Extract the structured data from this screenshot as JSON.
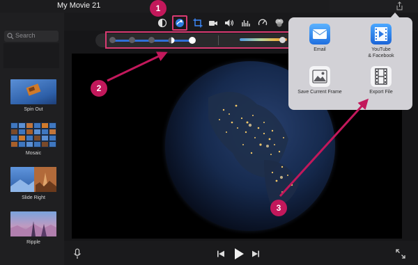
{
  "window": {
    "title": "My Movie 21"
  },
  "search": {
    "placeholder": "Search"
  },
  "transitions": [
    {
      "label": "Spin Out"
    },
    {
      "label": "Mosaic"
    },
    {
      "label": "Slide Right"
    },
    {
      "label": "Ripple"
    }
  ],
  "share_menu": {
    "items": [
      {
        "label": "Email",
        "icon": "mail-icon"
      },
      {
        "label": "YouTube\n& Facebook",
        "line1": "YouTube",
        "line2": "& Facebook",
        "icon": "video-upload-icon"
      },
      {
        "label": "Save Current Frame",
        "icon": "image-icon"
      },
      {
        "label": "Export File",
        "icon": "film-icon"
      }
    ]
  },
  "annotations": {
    "steps": [
      "1",
      "2",
      "3"
    ]
  },
  "colors": {
    "accent": "#2f6fd9",
    "annotation": "#c2185b",
    "highlight_box": "#d93a72",
    "popover_bg": "#d2d1d6"
  },
  "adjust_slider": {
    "value_fraction": 0.75
  }
}
